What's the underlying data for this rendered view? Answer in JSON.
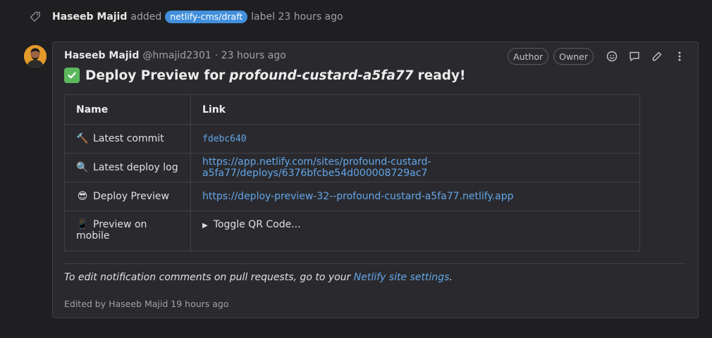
{
  "event": {
    "author": "Haseeb Majid",
    "action": "added",
    "label": "netlify-cms/draft",
    "suffix": "label 23 hours ago"
  },
  "note": {
    "author": "Haseeb Majid",
    "handle": "@hmajid2301",
    "time": "· 23 hours ago",
    "badges": {
      "author": "Author",
      "owner": "Owner"
    },
    "title": {
      "prefix": "Deploy Preview for",
      "site": "profound-custard-a5fa77",
      "suffix": "ready!"
    },
    "table": {
      "headers": {
        "name": "Name",
        "link": "Link"
      },
      "rows": [
        {
          "emoji": "🔨",
          "name": "Latest commit",
          "value": "fdebc640"
        },
        {
          "emoji": "🔍",
          "name": "Latest deploy log",
          "value": "https://app.netlify.com/sites/profound-custard-a5fa77/deploys/6376bfcbe54d000008729ac7"
        },
        {
          "emoji": "😎",
          "name": "Deploy Preview",
          "value": "https://deploy-preview-32--profound-custard-a5fa77.netlify.app"
        },
        {
          "emoji": "📱",
          "name": "Preview on mobile",
          "value": "Toggle QR Code..."
        }
      ]
    },
    "footer": {
      "text": "To edit notification comments on pull requests, go to your",
      "link": "Netlify site settings",
      "end": "."
    },
    "edited": "Edited by Haseeb Majid 19 hours ago"
  },
  "colors": {
    "accent": "#428fdc",
    "link": "#63a6e9",
    "background": "#1f1f22",
    "card": "#2a2a2e",
    "success": "#5cb85c"
  },
  "icons": [
    "tag-icon",
    "emoji-icon",
    "comment-icon",
    "edit-icon",
    "more-actions-icon",
    "check-icon"
  ]
}
